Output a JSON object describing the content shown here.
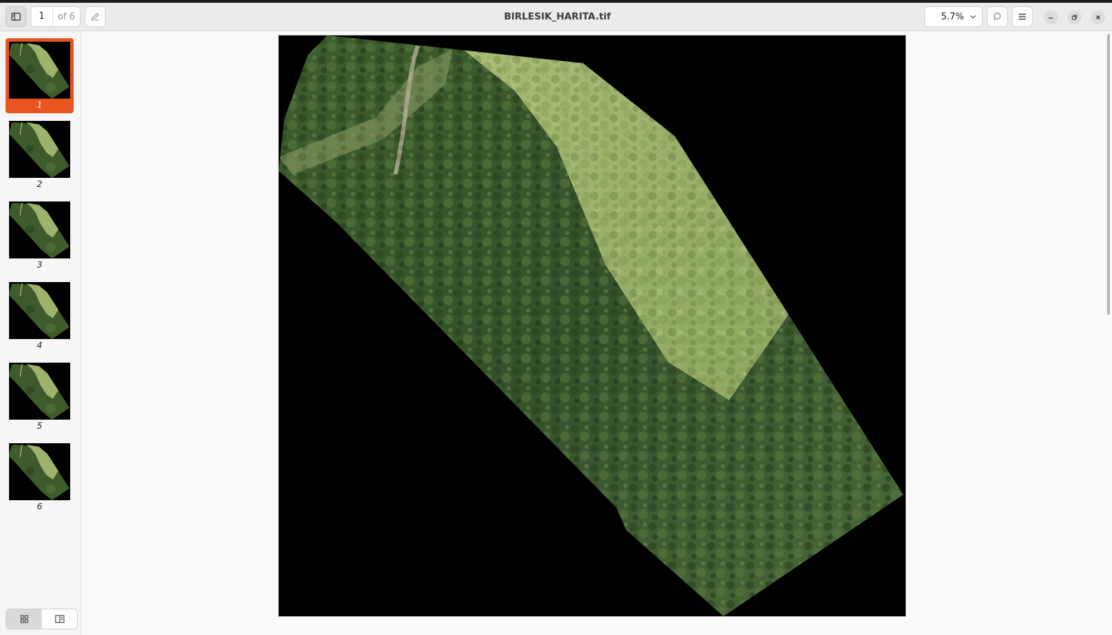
{
  "header": {
    "title": "BIRLESIK_HARITA.tif",
    "page": {
      "current": "1",
      "total_label": "of 6"
    },
    "zoom": "5.7%"
  },
  "icons": {
    "sidebar_toggle": "sidebar-toggle-icon",
    "annotate": "pencil-icon",
    "search": "search-icon",
    "menu": "hamburger-menu-icon",
    "minimize": "minimize-icon",
    "restore": "restore-icon",
    "close": "close-icon"
  },
  "sidebar": {
    "thumbnails": [
      {
        "label": "1",
        "selected": true
      },
      {
        "label": "2",
        "selected": false
      },
      {
        "label": "3",
        "selected": false
      },
      {
        "label": "4",
        "selected": false
      },
      {
        "label": "5",
        "selected": false
      },
      {
        "label": "6",
        "selected": false
      }
    ]
  },
  "colors": {
    "accent": "#e95420",
    "page_background": "#000000",
    "forest_dark": "#2f4a22",
    "forest": "#4a6a33",
    "meadow": "#9bb06a"
  }
}
